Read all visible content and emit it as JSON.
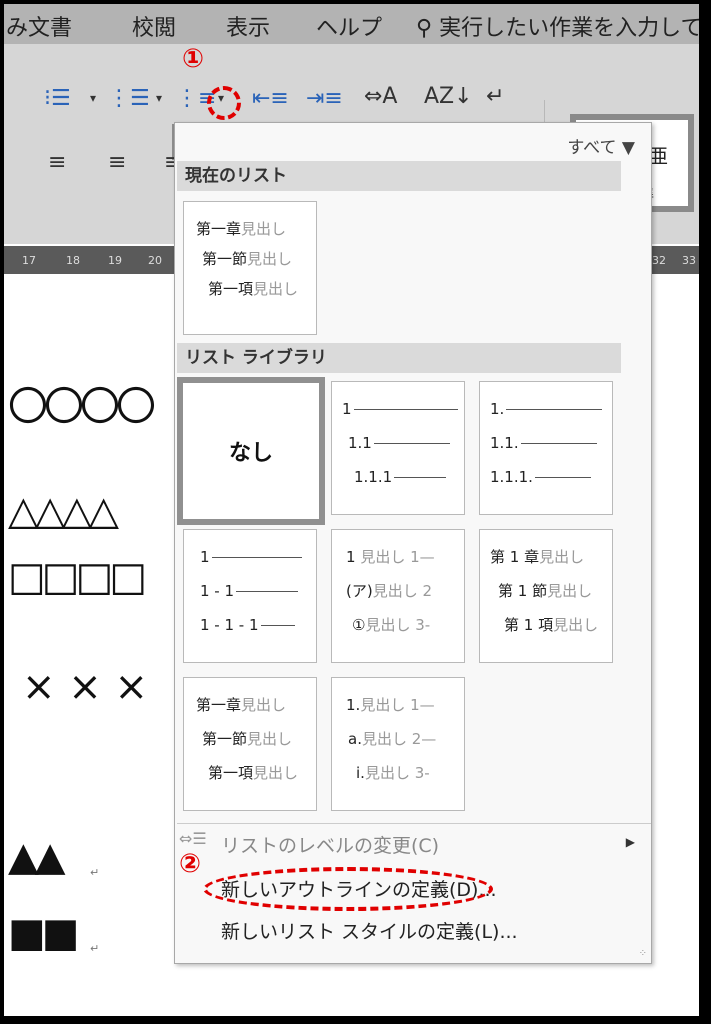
{
  "menu": {
    "items": [
      "み文書",
      "校閲",
      "表示",
      "ヘルプ"
    ],
    "search_icon": "search-icon",
    "search_text": "実行したい作業を入力して"
  },
  "ribbon": {
    "style_preview": "あア亜",
    "style_partial": "準"
  },
  "annotations": {
    "step1": "①",
    "step2": "②",
    "accent_color": "#e00000"
  },
  "ruler": [
    "17",
    "18",
    "19",
    "20",
    "32",
    "33"
  ],
  "document": {
    "circles": "〇〇〇〇",
    "triangles": "△△△△",
    "squares": "□□□□",
    "crosses": "× × ×",
    "black_triangles": "▲▲",
    "black_squares": "■■",
    "para_mark": "↵"
  },
  "dropdown": {
    "filter_label": "すべて",
    "section_current": "現在のリスト",
    "section_library": "リスト ライブラリ",
    "current_tile": {
      "lines": [
        {
          "a": "第一章",
          "b": "見出し"
        },
        {
          "a": "第一節",
          "b": "見出し"
        },
        {
          "a": "第一項",
          "b": "見出し"
        }
      ]
    },
    "none_label": "なし",
    "tile_num_dot": {
      "lines": [
        "1",
        "1.1",
        "1.1.1"
      ]
    },
    "tile_num_trailing": {
      "lines": [
        "1.",
        "1.1.",
        "1.1.1."
      ]
    },
    "tile_hyphen": {
      "lines": [
        "1",
        "1 - 1",
        "1 - 1 - 1"
      ]
    },
    "tile_heading_mixed": {
      "lines": [
        {
          "a": "1",
          "b": "見出し 1—"
        },
        {
          "a": "(ア)",
          "b": "見出し 2"
        },
        {
          "a": "①",
          "b": "見出し 3-"
        }
      ]
    },
    "tile_chapter_num": {
      "lines": [
        {
          "a": "第 1 章",
          "b": "見出し"
        },
        {
          "a": "第 1 節",
          "b": "見出し"
        },
        {
          "a": "第 1 項",
          "b": "見出し"
        }
      ]
    },
    "tile_chapter_kanji": {
      "lines": [
        {
          "a": "第一章",
          "b": "見出し"
        },
        {
          "a": "第一節",
          "b": "見出し"
        },
        {
          "a": "第一項",
          "b": "見出し"
        }
      ]
    },
    "tile_alpha_roman": {
      "lines": [
        {
          "a": "1.",
          "b": "見出し 1—"
        },
        {
          "a": "a.",
          "b": "見出し 2—"
        },
        {
          "a": "i.",
          "b": "見出し 3-"
        }
      ]
    },
    "cmd_change_level": "リストのレベルの変更(C)",
    "cmd_new_outline": "新しいアウトラインの定義(D)...",
    "cmd_new_style": "新しいリスト スタイルの定義(L)..."
  }
}
